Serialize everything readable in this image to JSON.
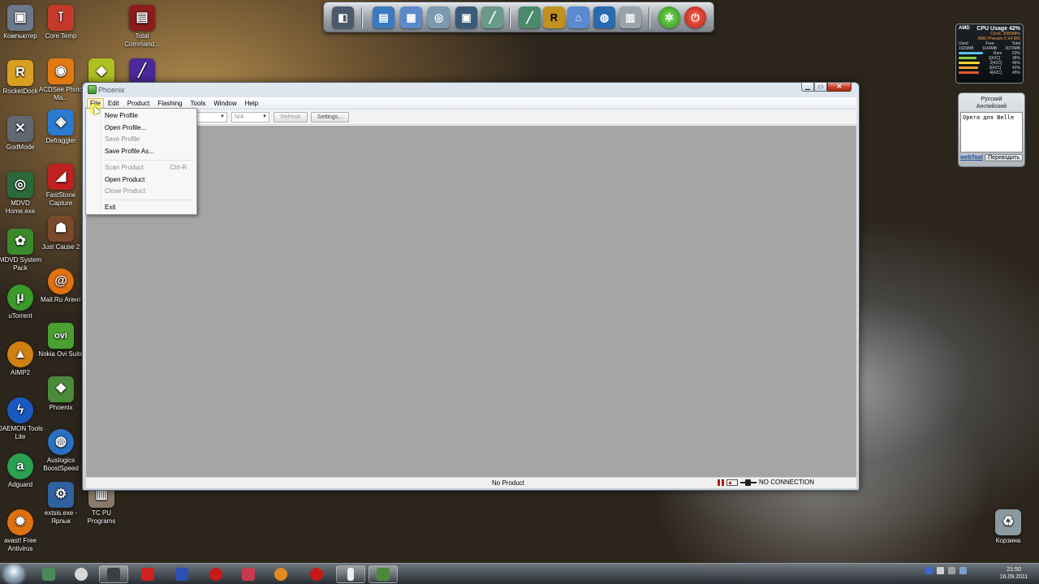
{
  "desktop": {
    "icons": [
      {
        "label": "Компьютер",
        "icon": "computer-icon",
        "color": "#6a7a8a"
      },
      {
        "label": "Core Temp",
        "icon": "thermometer-icon",
        "color": "#c43a2a"
      },
      {
        "label": "Total Command...",
        "icon": "total-commander-icon",
        "color": "#8a1c1c"
      },
      {
        "label": "RocketDock",
        "icon": "rocketdock-icon",
        "color": "#d8a020"
      },
      {
        "label": "ACDSee Photo Ma...",
        "icon": "acdsee-icon",
        "color": "#e07a10"
      },
      {
        "label": "",
        "icon": "yellow-green-icon",
        "color": "#b0c020"
      },
      {
        "label": "",
        "icon": "purple-app-icon",
        "color": "#4a2a9a"
      },
      {
        "label": "GodMode",
        "icon": "wrench-icon",
        "color": "#606870"
      },
      {
        "label": "Defraggler",
        "icon": "defraggler-icon",
        "color": "#2a7ad0"
      },
      {
        "label": "MDVD Home.exe",
        "icon": "mdvd-home-icon",
        "color": "#2a6a3a"
      },
      {
        "label": "FastStone Capture",
        "icon": "faststone-icon",
        "color": "#c02020"
      },
      {
        "label": "MDVD System Pack",
        "icon": "mdvd-pack-icon",
        "color": "#3a8a2a"
      },
      {
        "label": "Just Cause 2",
        "icon": "just-cause-icon",
        "color": "#7a4a2a"
      },
      {
        "label": "uTorrent",
        "icon": "utorrent-icon",
        "color": "#3a9a2a"
      },
      {
        "label": "Mail.Ru Агент",
        "icon": "mailru-icon",
        "color": "#e07010"
      },
      {
        "label": "AIMP2",
        "icon": "aimp-icon",
        "color": "#d08010"
      },
      {
        "label": "Nokia Ovi Suite",
        "icon": "ovi-icon",
        "color": "#4aa030"
      },
      {
        "label": "DAEMON Tools Lite",
        "icon": "daemon-icon",
        "color": "#1a5ac0"
      },
      {
        "label": "Phoenix",
        "icon": "phoenix-icon",
        "color": "#4a8a3a"
      },
      {
        "label": "Adguard",
        "icon": "adguard-icon",
        "color": "#2aa050"
      },
      {
        "label": "Auslogics BoostSpeed",
        "icon": "auslogics-icon",
        "color": "#2a70c0"
      },
      {
        "label": "avast! Free Antivirus",
        "icon": "avast-icon",
        "color": "#e07010"
      },
      {
        "label": "extsis.exe - Ярлык",
        "icon": "extsis-icon",
        "color": "#3060a0"
      },
      {
        "label": "TC PU Programs",
        "icon": "tc-pu-icon",
        "color": "#8a7a6a"
      },
      {
        "label": "Корзина",
        "icon": "recycle-bin-icon",
        "color": "#8a9aa0"
      }
    ]
  },
  "dock": {
    "items": [
      "finder-icon",
      "notes-icon",
      "documents-icon",
      "disc-icon",
      "photos-icon",
      "editor-icon",
      "tools-icon",
      "rocketdock-r-icon",
      "network-icon",
      "browser-icon",
      "trash-icon",
      "refresh-green-icon",
      "power-red-icon"
    ]
  },
  "cpu_gadget": {
    "title": "CPU Usage 42%",
    "brand": "AMD",
    "clock": "Clock: 3080MHz",
    "model": "AMD Phenom II X4 955",
    "headers": [
      "Used",
      "Free",
      "Total"
    ],
    "mem": [
      "1926MB",
      "1144MB",
      "3070MB"
    ],
    "ram_label": "Ram",
    "ram_pct": "63%",
    "cores": [
      {
        "label": "1[42C]",
        "pct": "36%"
      },
      {
        "label": "2[42C]",
        "pct": "46%"
      },
      {
        "label": "3[42C]",
        "pct": "42%"
      },
      {
        "label": "4[42C]",
        "pct": "45%"
      }
    ]
  },
  "translator": {
    "lang_from": "Русский",
    "lang_to": "Английский",
    "text": "Opera для Belle",
    "brand": "webTool",
    "translate_button": "Переводить"
  },
  "window": {
    "title": "Phoenix",
    "menu": [
      "File",
      "Edit",
      "Product",
      "Flashing",
      "Tools",
      "Window",
      "Help"
    ],
    "toolbar": {
      "combo2_value": "N/A",
      "refresh_label": "Refresh",
      "settings_label": "Settings..."
    },
    "status": {
      "center": "No Product",
      "connection": "NO CONNECTION"
    }
  },
  "file_menu": {
    "items": [
      {
        "label": "New Profile",
        "enabled": true
      },
      {
        "label": "Open Profile...",
        "enabled": true
      },
      {
        "label": "Save Profile",
        "enabled": false
      },
      {
        "label": "Save Profile As...",
        "enabled": true
      },
      {
        "label": "Scan Product",
        "shortcut": "Ctrl-R",
        "enabled": false
      },
      {
        "label": "Open Product",
        "enabled": true
      },
      {
        "label": "Close Product",
        "enabled": false
      },
      {
        "label": "Exit",
        "enabled": true
      }
    ]
  },
  "taskbar": {
    "clock_time": "21:50",
    "clock_date": "16.09.2011",
    "apps": [
      "media-icon",
      "play-icon",
      "explorer-icon",
      "faststone-task-icon",
      "save-icon",
      "opera-icon",
      "ipod-icon",
      "mail-icon",
      "opera2-icon",
      "phone-icon",
      "phoenix-task-icon"
    ]
  }
}
